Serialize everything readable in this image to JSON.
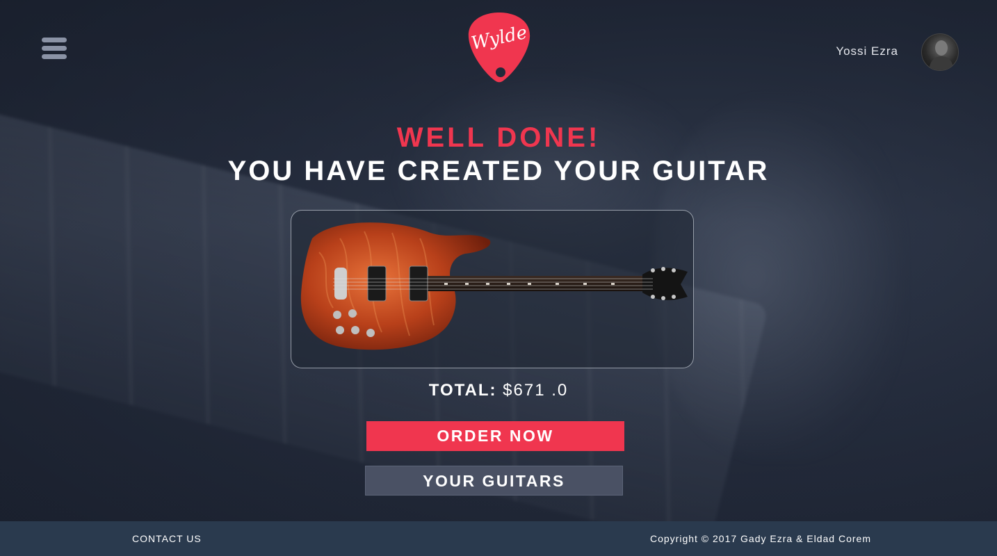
{
  "header": {
    "logo_text": "Wylde",
    "user_name": "Yossi Ezra"
  },
  "main": {
    "title_line1": "WELL DONE!",
    "title_line2": "YOU HAVE CREATED YOUR GUITAR",
    "total_label": "TOTAL:",
    "total_value": "$671 .0",
    "order_button": "ORDER NOW",
    "guitars_button": "YOUR GUITARS"
  },
  "footer": {
    "contact": "CONTACT US",
    "copyright": "Copyright © 2017 Gady Ezra & Eldad Corem"
  },
  "colors": {
    "accent": "#f0364f",
    "footer_bg": "#2a3a4e",
    "secondary_button": "#4a5164"
  }
}
